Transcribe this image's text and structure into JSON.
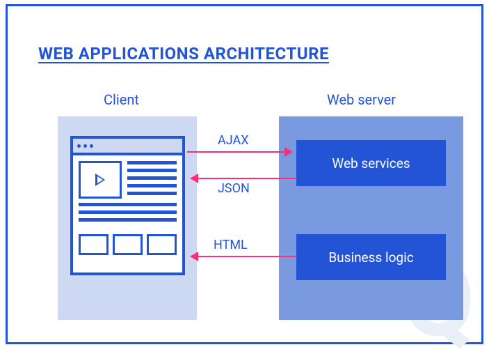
{
  "title": "WEB APPLICATIONS ARCHITECTURE",
  "columns": {
    "client_label": "Client",
    "server_label": "Web server"
  },
  "server_boxes": {
    "web_services": "Web services",
    "business_logic": "Business logic"
  },
  "arrows": {
    "ajax": "AJAX",
    "json": "JSON",
    "html": "HTML"
  },
  "watermark": "Q"
}
